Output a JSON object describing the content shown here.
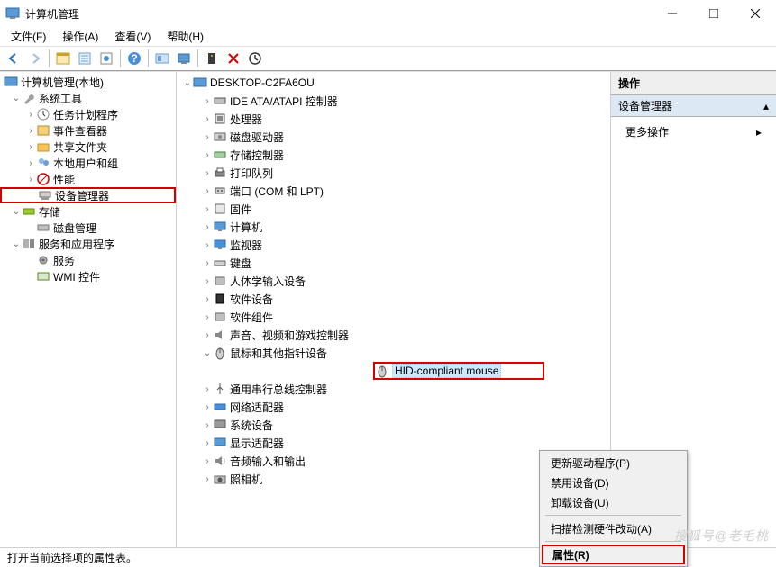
{
  "window": {
    "title": "计算机管理"
  },
  "menu": {
    "file": "文件(F)",
    "action": "操作(A)",
    "view": "查看(V)",
    "help": "帮助(H)"
  },
  "left": {
    "root": "计算机管理(本地)",
    "sys_tools": "系统工具",
    "task_sched": "任务计划程序",
    "event_viewer": "事件查看器",
    "shared_folders": "共享文件夹",
    "local_users": "本地用户和组",
    "performance": "性能",
    "device_mgr": "设备管理器",
    "storage": "存储",
    "disk_mgmt": "磁盘管理",
    "services_apps": "服务和应用程序",
    "services": "服务",
    "wmi": "WMI 控件"
  },
  "dev": {
    "root": "DESKTOP-C2FA6OU",
    "ide": "IDE ATA/ATAPI 控制器",
    "processors": "处理器",
    "disk_drives": "磁盘驱动器",
    "storage_ctrl": "存储控制器",
    "print_queues": "打印队列",
    "ports": "端口 (COM 和 LPT)",
    "firmware": "固件",
    "computer": "计算机",
    "monitors": "监视器",
    "keyboards": "键盘",
    "hid": "人体学输入设备",
    "sw_devices": "软件设备",
    "sw_components": "软件组件",
    "sound": "声音、视频和游戏控制器",
    "mouse": "鼠标和其他指针设备",
    "hid_mouse": "HID-compliant mouse",
    "usb": "通用串行总线控制器",
    "network": "网络适配器",
    "system_devices": "系统设备",
    "display": "显示适配器",
    "audio_io": "音频输入和输出",
    "cameras": "照相机"
  },
  "ctx": {
    "update_driver": "更新驱动程序(P)",
    "disable": "禁用设备(D)",
    "uninstall": "卸载设备(U)",
    "scan": "扫描检测硬件改动(A)",
    "properties": "属性(R)"
  },
  "actions": {
    "header": "操作",
    "subheader": "设备管理器",
    "more": "更多操作"
  },
  "status": "打开当前选择项的属性表。",
  "watermark": "搜狐号@老毛桃"
}
